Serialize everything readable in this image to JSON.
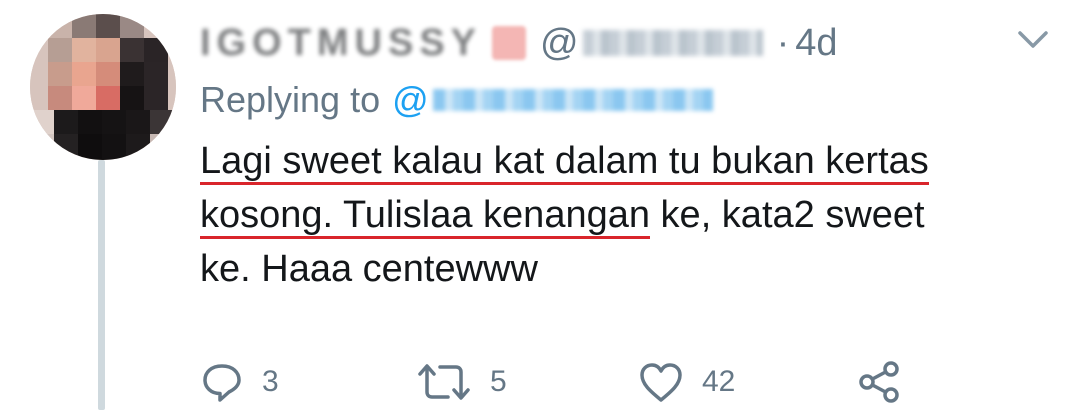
{
  "tweet": {
    "display_name": "IGOTMUSSY",
    "handle_prefix": "@",
    "separator": "·",
    "time": "4d",
    "replying_label": "Replying to",
    "reply_handle_prefix": "@",
    "text_lines": [
      {
        "highlighted": "Lagi sweet kalau kat dalam tu bukan kertas",
        "rest": ""
      },
      {
        "highlighted": "kosong. Tulislaa kenangan",
        "rest": " ke, kata2 sweet"
      },
      {
        "highlighted": "",
        "rest": "ke. Haaa centewww"
      }
    ]
  },
  "actions": {
    "reply_count": "3",
    "retweet_count": "5",
    "like_count": "42"
  },
  "icons": {
    "reply": "reply-icon",
    "retweet": "retweet-icon",
    "like": "heart-icon",
    "share": "share-icon",
    "more": "chevron-down-icon"
  },
  "colors": {
    "text": "#14171a",
    "muted": "#657786",
    "link": "#1da1f2",
    "highlight_underline": "#d9252b",
    "thread_line": "#cfd9de"
  }
}
